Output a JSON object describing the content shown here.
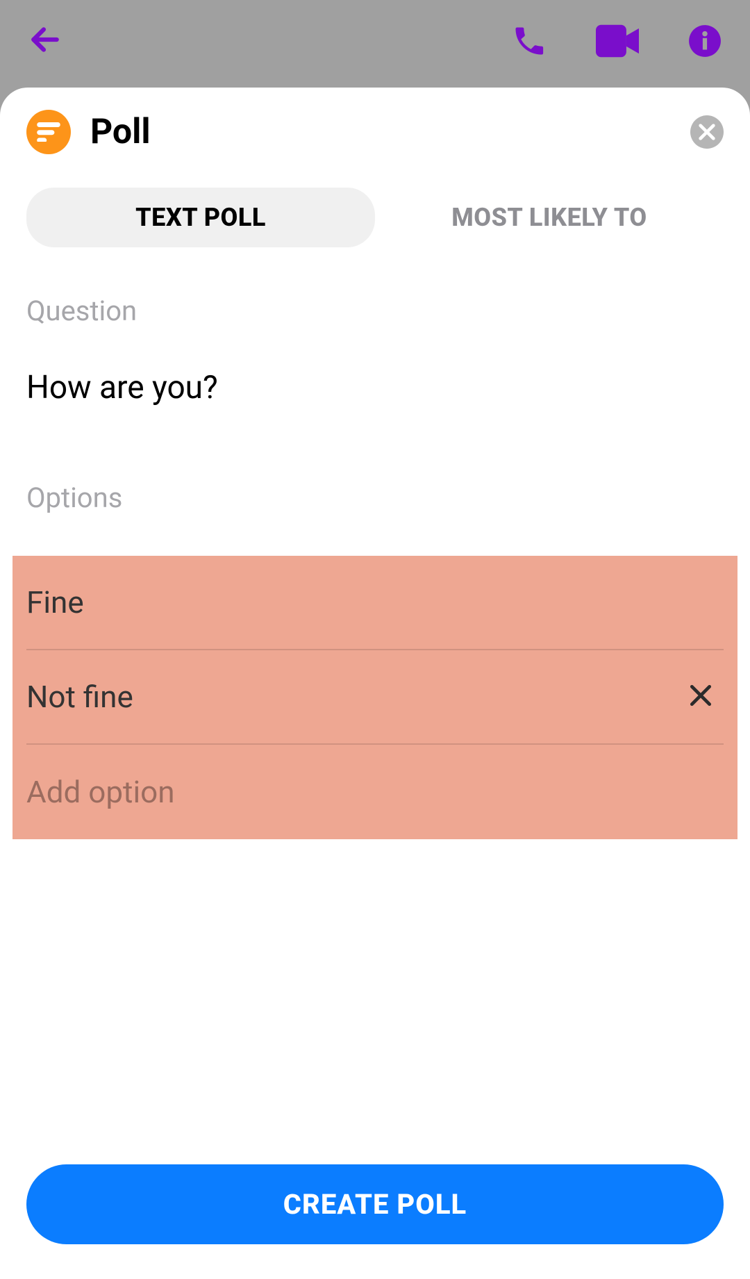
{
  "sheet": {
    "title": "Poll",
    "tabs": [
      {
        "label": "TEXT POLL",
        "active": true
      },
      {
        "label": "MOST LIKELY TO",
        "active": false
      }
    ],
    "question_label": "Question",
    "question_value": "How are you?",
    "options_label": "Options",
    "options": [
      {
        "value": "Fine",
        "removable": false
      },
      {
        "value": "Not fine",
        "removable": true
      }
    ],
    "add_option_placeholder": "Add option",
    "create_button": "CREATE POLL"
  }
}
